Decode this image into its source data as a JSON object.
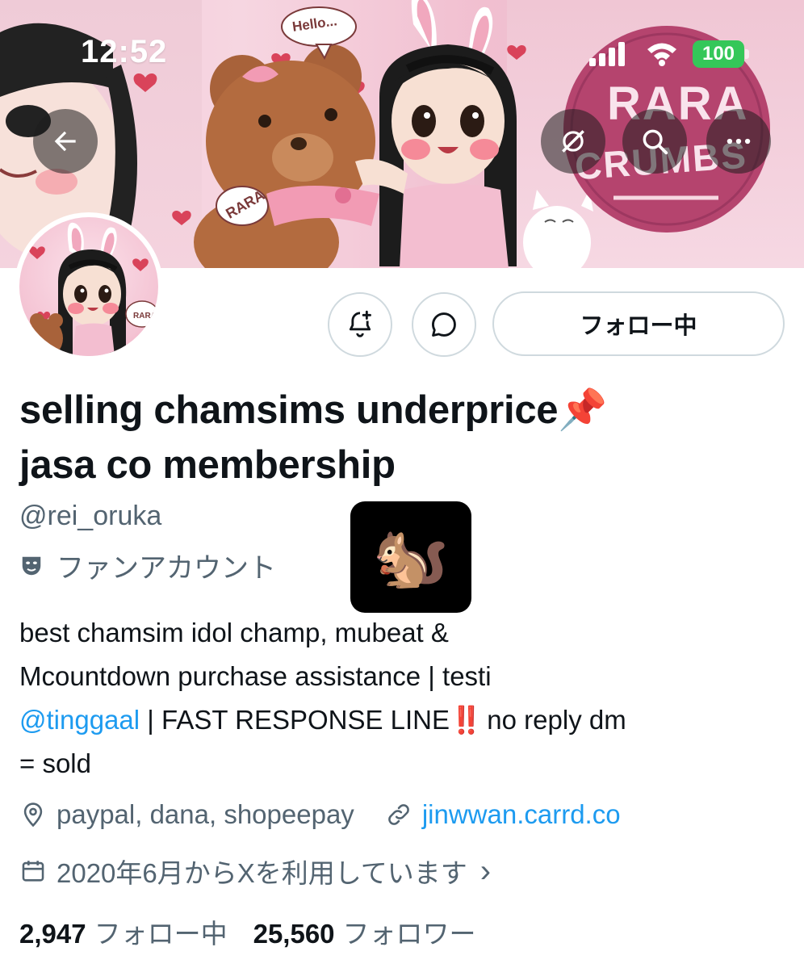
{
  "status_bar": {
    "time": "12:52",
    "battery_percent": "100",
    "battery_color": "#34c759"
  },
  "banner": {
    "hello_text": "Hello...",
    "rara_tag": "RARA",
    "logo_line1": "RARA",
    "logo_line2": "CRUMBS",
    "back_icon": "arrow-left-icon",
    "grok_icon": "grok-icon",
    "search_icon": "search-icon",
    "more_icon": "more-icon"
  },
  "actions": {
    "notify_icon": "bell-plus-icon",
    "message_icon": "message-icon",
    "follow_label": "フォロー中"
  },
  "profile": {
    "display_name_line1": "selling chamsims underprice",
    "display_name_emoji": "📌",
    "display_name_line2": "jasa co membership",
    "handle": "@rei_oruka",
    "category": "ファンアカウント",
    "category_icon": "theater-mask-icon",
    "squirrel_emoji": "🐿️",
    "bio": {
      "part1": "best chamsim idol champ, mubeat &",
      "part2": "Mcountdown purchase assistance | testi",
      "mention": "@tinggaal",
      "part3": " | FAST RESPONSE LINE",
      "emphasis": "‼️",
      "part4": " no reply dm",
      "part5": "= sold"
    },
    "location": "paypal, dana, shopeepay",
    "location_icon": "location-pin-icon",
    "website": "jinwwan.carrd.co",
    "website_icon": "link-icon",
    "joined": "2020年6月からXを利用しています",
    "joined_icon": "calendar-icon",
    "joined_chevron": "›"
  },
  "stats": {
    "following_count": "2,947",
    "following_label": "フォロー中",
    "followers_count": "25,560",
    "followers_label": "フォロワー"
  },
  "colors": {
    "accent": "#1d9bf0",
    "secondary_text": "#536471",
    "primary_text": "#0f1419",
    "border": "#cfd9de"
  }
}
